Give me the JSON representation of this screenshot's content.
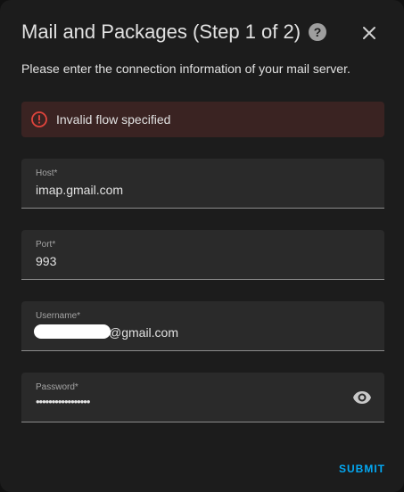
{
  "dialog": {
    "title": "Mail and Packages (Step 1 of 2)",
    "help_icon": "help-circle-icon",
    "close_icon": "close-icon",
    "description": "Please enter the connection information of your mail server."
  },
  "error": {
    "icon": "alert-circle-icon",
    "text": "Invalid flow specified",
    "color": "#e0443c"
  },
  "fields": {
    "host": {
      "label": "Host*",
      "value": "imap.gmail.com"
    },
    "port": {
      "label": "Port*",
      "value": "993"
    },
    "username": {
      "label": "Username*",
      "value": "@gmail.com"
    },
    "password": {
      "label": "Password*",
      "value": "•••••••••••••••••",
      "toggle_icon": "eye-icon"
    }
  },
  "actions": {
    "submit_label": "SUBMIT"
  },
  "colors": {
    "accent": "#03a9f4",
    "dialog_bg": "#1c1c1c",
    "field_bg": "#2a2a2a",
    "error_bg": "#3a2322"
  }
}
